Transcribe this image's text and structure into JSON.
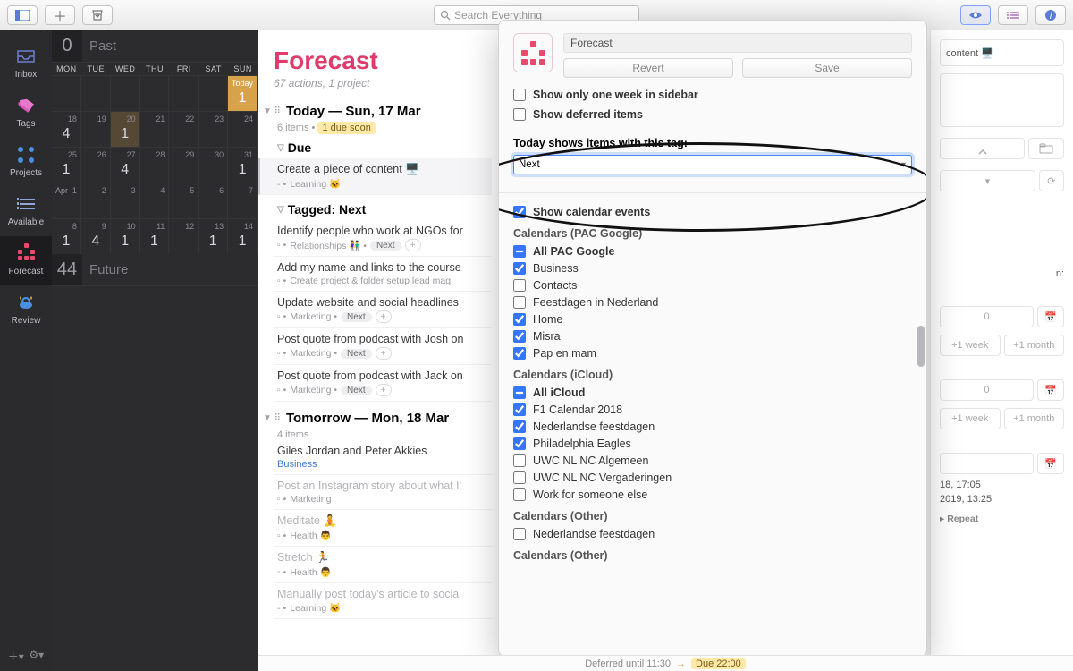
{
  "toolbar": {
    "search_placeholder": "Search Everything"
  },
  "nav": {
    "inbox": "Inbox",
    "tags": "Tags",
    "projects": "Projects",
    "available": "Available",
    "forecast": "Forecast",
    "review": "Review"
  },
  "calendar": {
    "past_label": "Past",
    "past_count": "0",
    "future_label": "Future",
    "future_count": "44",
    "dow": [
      "MON",
      "TUE",
      "WED",
      "THU",
      "FRI",
      "SAT",
      "SUN"
    ],
    "today_label": "Today",
    "cells": [
      {
        "dn": "",
        "cnt": ""
      },
      {
        "dn": "",
        "cnt": ""
      },
      {
        "dn": "",
        "cnt": ""
      },
      {
        "dn": "",
        "cnt": ""
      },
      {
        "dn": "",
        "cnt": ""
      },
      {
        "dn": "",
        "cnt": ""
      },
      {
        "dn": "",
        "cnt": "1",
        "today": true
      },
      {
        "dn": "18",
        "cnt": "4"
      },
      {
        "dn": "19",
        "cnt": ""
      },
      {
        "dn": "20",
        "cnt": "1",
        "hl": true
      },
      {
        "dn": "21",
        "cnt": ""
      },
      {
        "dn": "22",
        "cnt": ""
      },
      {
        "dn": "23",
        "cnt": ""
      },
      {
        "dn": "24",
        "cnt": ""
      },
      {
        "dn": "25",
        "cnt": "1"
      },
      {
        "dn": "26",
        "cnt": ""
      },
      {
        "dn": "27",
        "cnt": "4"
      },
      {
        "dn": "28",
        "cnt": ""
      },
      {
        "dn": "29",
        "cnt": ""
      },
      {
        "dn": "30",
        "cnt": ""
      },
      {
        "dn": "31",
        "cnt": "1"
      },
      {
        "dn": "1",
        "cnt": "",
        "mo": "Apr"
      },
      {
        "dn": "2",
        "cnt": ""
      },
      {
        "dn": "3",
        "cnt": ""
      },
      {
        "dn": "4",
        "cnt": ""
      },
      {
        "dn": "5",
        "cnt": ""
      },
      {
        "dn": "6",
        "cnt": ""
      },
      {
        "dn": "7",
        "cnt": ""
      },
      {
        "dn": "8",
        "cnt": "1"
      },
      {
        "dn": "9",
        "cnt": "4"
      },
      {
        "dn": "10",
        "cnt": "1"
      },
      {
        "dn": "11",
        "cnt": "1"
      },
      {
        "dn": "12",
        "cnt": ""
      },
      {
        "dn": "13",
        "cnt": "1"
      },
      {
        "dn": "14",
        "cnt": "1"
      }
    ]
  },
  "main": {
    "title": "Forecast",
    "subtitle": "67 actions, 1 project",
    "today_hd": "Today — Sun, 17 Mar",
    "today_sub_items": "6 items •",
    "today_sub_due": "1 due soon",
    "due_hd": "Due",
    "tagged_hd": "Tagged: Next",
    "tomorrow_hd": "Tomorrow — Mon, 18 Mar",
    "tomorrow_sub": "4 items",
    "tasks": {
      "t1_title": "Create a piece of content 🖥️",
      "t1_meta": "Learning 🐱",
      "t2_title": "Identify people who work at NGOs for",
      "t2_meta": "Relationships 👫 •",
      "t2_tag": "Next",
      "t3_title": "Add my name and links to the course",
      "t3_meta": "Create project & folder setup lead mag",
      "t4_title": "Update website and social headlines",
      "t4_meta": "Marketing •",
      "t4_tag": "Next",
      "t5_title": "Post quote from podcast with Josh on",
      "t5_meta": "Marketing •",
      "t5_tag": "Next",
      "t6_title": "Post quote from podcast with Jack on",
      "t6_meta": "Marketing •",
      "t6_tag": "Next",
      "t7_title": "Giles Jordan and Peter Akkies",
      "t7_cal": "Business",
      "t8_title": "Post an Instagram story about what I'",
      "t8_meta": "Marketing",
      "t9_title": "Meditate 🧘",
      "t9_meta": "Health 👨",
      "t10_title": "Stretch 🏃",
      "t10_meta": "Health 👨",
      "t11_title": "Manually post today's article to socia",
      "t11_meta": "Learning 🐱"
    }
  },
  "popover": {
    "title": "Forecast",
    "revert": "Revert",
    "save": "Save",
    "show_week": "Show only one week in sidebar",
    "show_deferred": "Show deferred items",
    "tag_label": "Today shows items with this tag:",
    "tag_value": "Next",
    "show_cal": "Show calendar events",
    "group1": "Calendars (PAC Google)",
    "g1_all": "All PAC Google",
    "g1_items": [
      {
        "label": "Business",
        "checked": true
      },
      {
        "label": "Contacts",
        "checked": false
      },
      {
        "label": "Feestdagen in Nederland",
        "checked": false
      },
      {
        "label": "Home",
        "checked": true
      },
      {
        "label": "Misra",
        "checked": true
      },
      {
        "label": "Pap en mam",
        "checked": true
      }
    ],
    "group2": "Calendars (iCloud)",
    "g2_all": "All iCloud",
    "g2_items": [
      {
        "label": "F1 Calendar 2018",
        "checked": true
      },
      {
        "label": "Nederlandse feestdagen",
        "checked": true
      },
      {
        "label": "Philadelphia Eagles",
        "checked": true
      },
      {
        "label": "UWC NL NC Algemeen",
        "checked": false
      },
      {
        "label": "UWC NL NC Vergaderingen",
        "checked": false
      },
      {
        "label": "Work for someone else",
        "checked": false
      }
    ],
    "group3": "Calendars (Other)",
    "g3_items": [
      {
        "label": "Nederlandse feestdagen",
        "checked": false
      }
    ],
    "group4": "Calendars (Other)"
  },
  "inspector": {
    "content_label": "content 🖥️",
    "plus1w": "+1 week",
    "plus1m": "+1 month",
    "zero": "0",
    "date1": "18, 17:05",
    "date2": "2019, 13:25",
    "repeat": "Repeat",
    "ends_n": "n:"
  },
  "status": {
    "deferred": "Deferred until 11:30",
    "due": "Due 22:00"
  }
}
